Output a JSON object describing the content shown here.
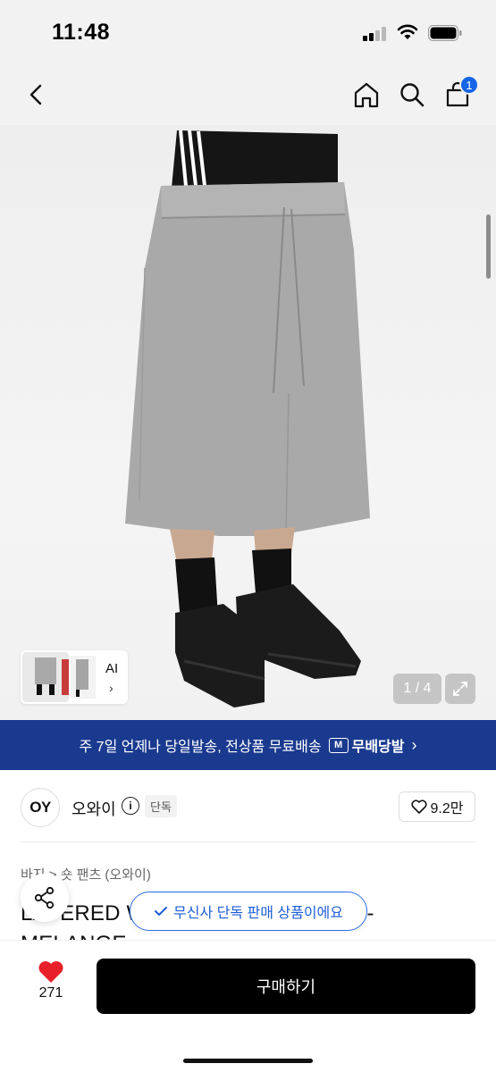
{
  "status_bar": {
    "time": "11:48"
  },
  "nav": {
    "cart_count": "1"
  },
  "gallery": {
    "thumb_label": "AI",
    "counter": "1 / 4"
  },
  "shipping": {
    "text": "주 7일 언제나 당일발송, 전상품 무료배송",
    "badge": "무배당발",
    "badge_icon_letter": "M"
  },
  "brand": {
    "logo_text": "OY",
    "name": "오와이",
    "tag": "단독",
    "likes": "9.2만"
  },
  "product": {
    "breadcrumb": "바지 > 숏 팬츠 (오와이)",
    "title": "LAYERED WIDE SWEAT SHORTS - MELANGE"
  },
  "toast": {
    "text": "무신사 단독 판매 상품이에요"
  },
  "bottom": {
    "like_count": "271",
    "buy_label": "구매하기"
  },
  "colors": {
    "shipping_bg": "#1a3a8f",
    "accent": "#1565e6",
    "heart": "#e8202a"
  }
}
